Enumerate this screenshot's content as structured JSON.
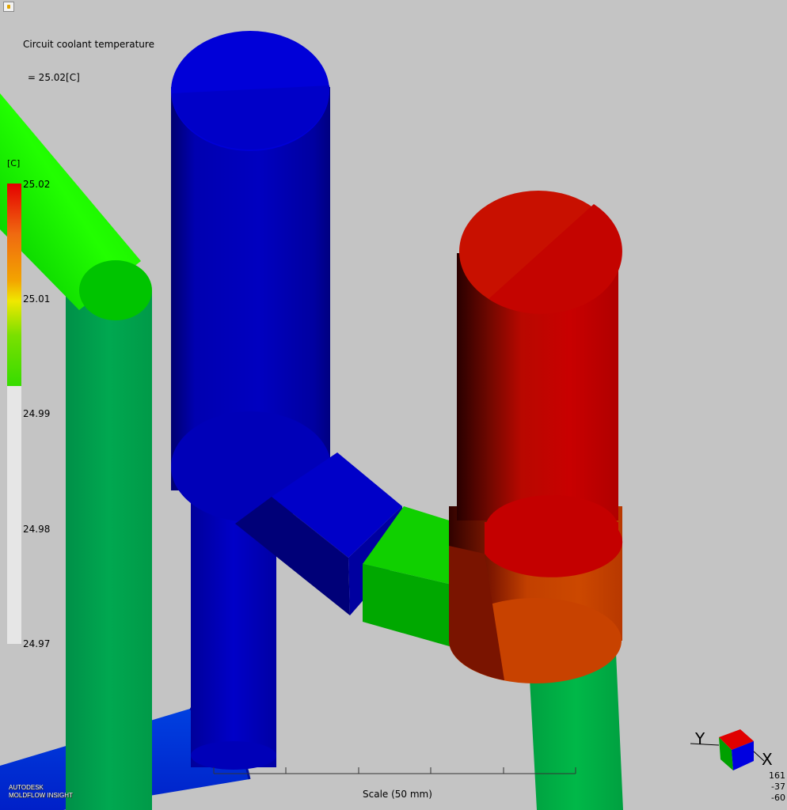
{
  "result": {
    "title": "Circuit coolant temperature",
    "value": " = 25.02[C]"
  },
  "legend": {
    "unit": "[C]",
    "ticks": [
      {
        "label": "25.02",
        "value": 25.02
      },
      {
        "label": "25.01",
        "value": 25.01
      },
      {
        "label": "24.99",
        "value": 24.99
      },
      {
        "label": "24.98",
        "value": 24.98
      },
      {
        "label": "24.97",
        "value": 24.97
      }
    ],
    "colors": {
      "max": "#e40000",
      "mid": "#f0e800",
      "low": "#36dc00",
      "below_range": "#e6e6e6"
    }
  },
  "scale_bar": {
    "label": "Scale (50 mm)",
    "divisions": 5
  },
  "triad": {
    "y_label": "Y",
    "x_label": "X"
  },
  "coordinates": [
    "161",
    "-37",
    "-60"
  ],
  "logo": {
    "line1": "AUTODESK",
    "line2": "MOLDFLOW INSIGHT"
  },
  "colors": {
    "background": "#c4c4c4",
    "blue_channel": "#0000c8",
    "red_channel": "#d41000",
    "green_channel": "#00b040"
  }
}
